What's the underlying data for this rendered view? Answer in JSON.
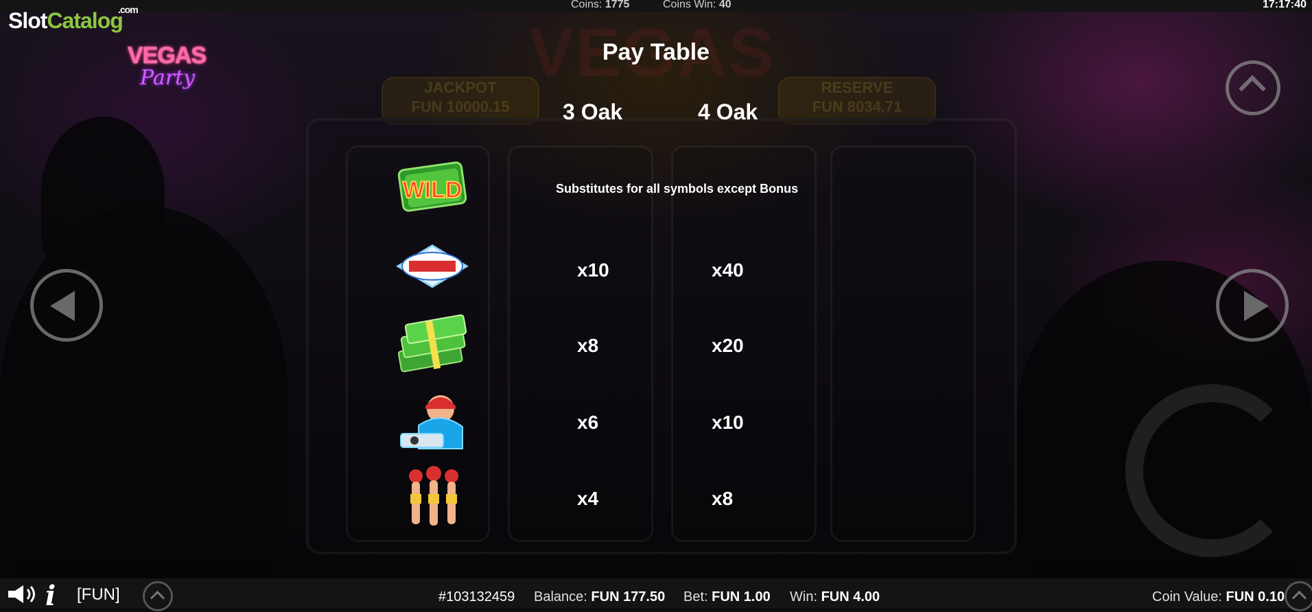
{
  "topbar": {
    "coins_label": "Coins:",
    "coins_value": "1775",
    "coins_win_label": "Coins Win:",
    "coins_win_value": "40",
    "clock": "17:17:40"
  },
  "watermark": {
    "slot": "Slot",
    "catalog": "Catalog",
    "com": ".com"
  },
  "game_logo": {
    "line1": "VEGAS",
    "line2": "Party"
  },
  "background": {
    "title": "VEGAS",
    "jackpot_label": "JACKPOT",
    "jackpot_value": "FUN 10000.15",
    "right_label": "RESERVE",
    "right_value": "FUN 8034.71"
  },
  "paytable": {
    "title": "Pay Table",
    "col_3oak": "3 Oak",
    "col_4oak": "4 Oak",
    "wild_desc": "Substitutes for all symbols except Bonus",
    "rows": [
      {
        "symbol": "las-vegas-sign",
        "oak3": "x10",
        "oak4": "x40"
      },
      {
        "symbol": "money-stack",
        "oak3": "x8",
        "oak4": "x20"
      },
      {
        "symbol": "dj",
        "oak3": "x6",
        "oak4": "x10"
      },
      {
        "symbol": "showgirls",
        "oak3": "x4",
        "oak4": "x8"
      }
    ]
  },
  "icons": {
    "wild": "wild-symbol-icon",
    "prev": "arrow-left-icon",
    "next": "arrow-right-icon",
    "up": "chevron-up-icon",
    "spin": "spin-refresh-icon"
  },
  "bottombar": {
    "currency_mode": "[FUN]",
    "round_id": "#103132459",
    "balance_label": "Balance:",
    "balance_value": "FUN 177.50",
    "bet_label": "Bet:",
    "bet_value": "FUN 1.00",
    "win_label": "Win:",
    "win_value": "FUN 4.00",
    "coin_value_label": "Coin Value:",
    "coin_value_value": "FUN 0.10"
  }
}
